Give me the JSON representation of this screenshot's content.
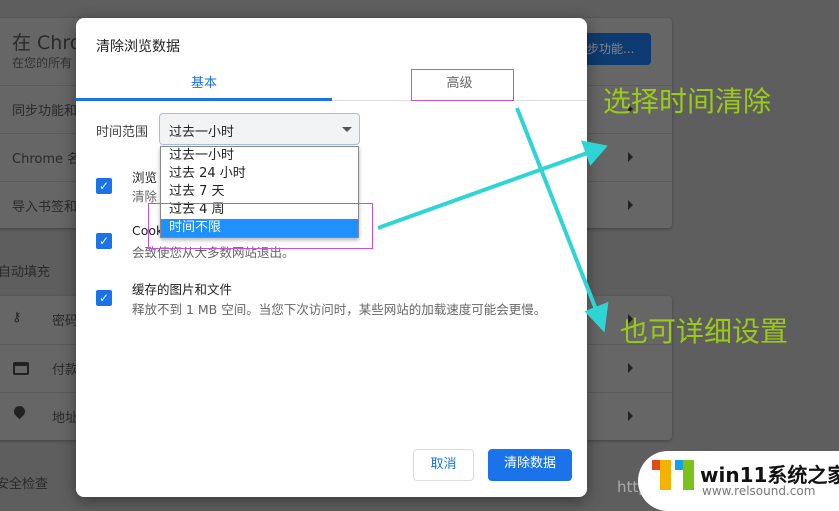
{
  "background": {
    "card1": {
      "header_title": "在 Chrom",
      "header_sub": "在您的所有",
      "sync_button": "步功能...",
      "rows": [
        "同步功能和",
        "Chrome 名",
        "导入书签和"
      ]
    },
    "autofill_heading": "自动填充",
    "card2": {
      "rows": [
        {
          "icon": "key-icon",
          "label": "密码"
        },
        {
          "icon": "credit-card-icon",
          "label": "付款"
        },
        {
          "icon": "location-pin-icon",
          "label": "地址"
        }
      ]
    },
    "safety_heading": "安全检查"
  },
  "dialog": {
    "title": "清除浏览数据",
    "tabs": [
      {
        "label": "基本",
        "active": true
      },
      {
        "label": "高级",
        "active": false
      }
    ],
    "time_range_label": "时间范围",
    "time_range_value": "过去一小时",
    "options": [
      "过去一小时",
      "过去 24 小时",
      "过去 7 天",
      "过去 4 周",
      "时间不限"
    ],
    "highlighted_option": "时间不限",
    "items": [
      {
        "title": "浏览",
        "desc": "清除",
        "checked": true
      },
      {
        "title": "Cook",
        "desc": "会致使您从大多数网站退出。",
        "checked": true
      },
      {
        "title": "缓存的图片和文件",
        "desc": "释放不到 1 MB 空间。当您下次访问时，某些网站的加载速度可能会更慢。",
        "checked": true
      }
    ],
    "cancel": "取消",
    "confirm": "清除数据"
  },
  "annotations": {
    "note1": "选择时间清除",
    "note2": "也可详细设置"
  },
  "watermark": {
    "url_fragment": "http",
    "brand": "win11系统之家",
    "site": "www.relsound.com"
  },
  "colors": {
    "accent": "#1a73e8",
    "annotation_green": "#9bc91a",
    "arrow": "#2fd5d5",
    "highlight_box": "#c94fd8"
  }
}
